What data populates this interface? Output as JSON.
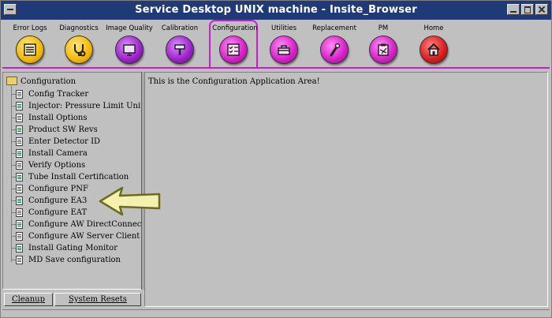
{
  "window": {
    "title": "Service Desktop UNIX machine - Insite_Browser"
  },
  "toolbar": {
    "items": [
      {
        "label": "Error Logs",
        "icon": "error-log-icon",
        "color": "#f2b705"
      },
      {
        "label": "Diagnostics",
        "icon": "stethoscope-icon",
        "color": "#f2b705"
      },
      {
        "label": "Image Quality",
        "icon": "monitor-icon",
        "color": "#9b20c8"
      },
      {
        "label": "Calibration",
        "icon": "calibration-icon",
        "color": "#9b20c8"
      },
      {
        "label": "Configuration",
        "icon": "checklist-icon",
        "color": "#d61ec9",
        "active": true
      },
      {
        "label": "Utilities",
        "icon": "toolbox-icon",
        "color": "#d61ec9"
      },
      {
        "label": "Replacement",
        "icon": "wrench-icon",
        "color": "#d61ec9"
      },
      {
        "label": "PM",
        "icon": "clipboard-icon",
        "color": "#d61ec9"
      },
      {
        "label": "Home",
        "icon": "home-icon",
        "color": "#d81b1b"
      }
    ],
    "accent": "#cc1ad0"
  },
  "tree": {
    "root": "Configuration",
    "items": [
      "Config Tracker",
      "Injector: Pressure Limit Unit",
      "Install Options",
      "Product SW Revs",
      "Enter Detector ID",
      "Install Camera",
      "Verify Options",
      "Tube Install Certification",
      "Configure PNF",
      "Configure EA3",
      "Configure EAT",
      "Configure AW DirectConnect",
      "Configure AW Server Client",
      "Install Gating Monitor",
      "MD Save configuration"
    ]
  },
  "buttons": {
    "cleanup": "Cleanup",
    "resets": "System Resets"
  },
  "main": {
    "message": "This is the Configuration Application Area!"
  },
  "annotation": {
    "arrow_color": "#f4f0b0",
    "arrow_outline": "#6b6b20"
  }
}
